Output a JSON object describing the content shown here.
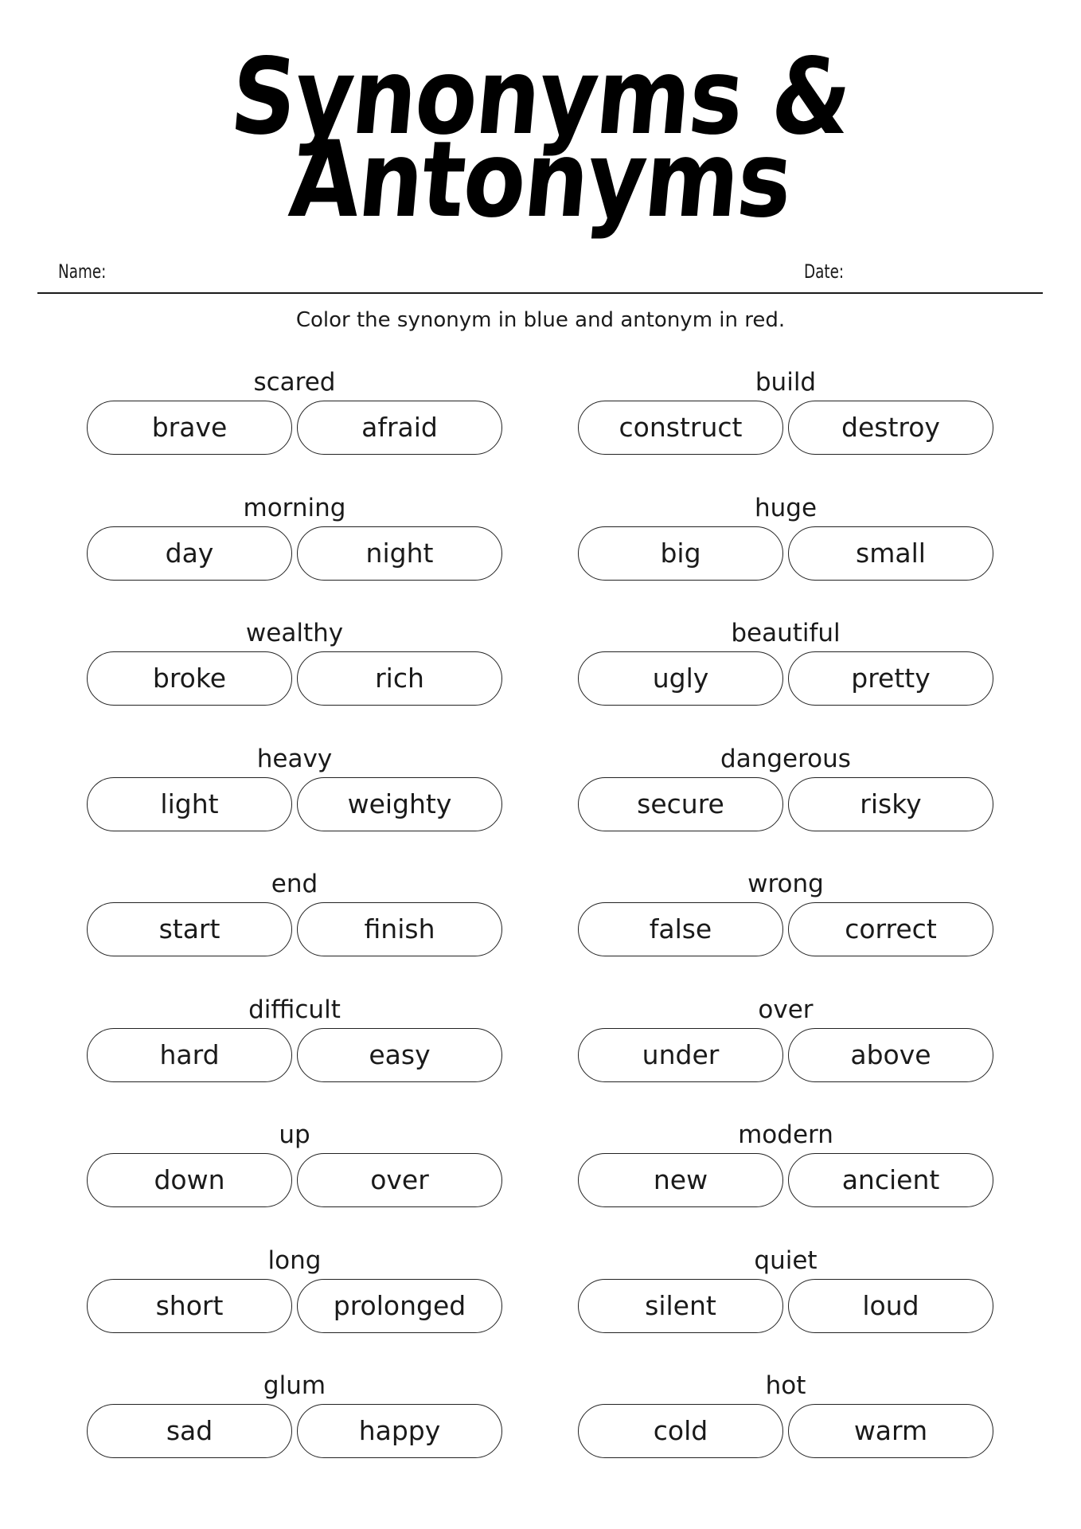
{
  "worksheet": {
    "title_line1": "Synonyms &",
    "title_line2": "Antonyms",
    "name_label": "Name:",
    "date_label": "Date:",
    "instructions": "Color the synonym in blue and antonym in red."
  },
  "left_column": [
    {
      "word": "scared",
      "options": [
        "brave",
        "afraid"
      ]
    },
    {
      "word": "morning",
      "options": [
        "day",
        "night"
      ]
    },
    {
      "word": "wealthy",
      "options": [
        "broke",
        "rich"
      ]
    },
    {
      "word": "heavy",
      "options": [
        "light",
        "weighty"
      ]
    },
    {
      "word": "end",
      "options": [
        "start",
        "finish"
      ]
    },
    {
      "word": "difficult",
      "options": [
        "hard",
        "easy"
      ]
    },
    {
      "word": "up",
      "options": [
        "down",
        "over"
      ]
    },
    {
      "word": "long",
      "options": [
        "short",
        "prolonged"
      ]
    },
    {
      "word": "glum",
      "options": [
        "sad",
        "happy"
      ]
    }
  ],
  "right_column": [
    {
      "word": "build",
      "options": [
        "construct",
        "destroy"
      ]
    },
    {
      "word": "huge",
      "options": [
        "big",
        "small"
      ]
    },
    {
      "word": "beautiful",
      "options": [
        "ugly",
        "pretty"
      ]
    },
    {
      "word": "dangerous",
      "options": [
        "secure",
        "risky"
      ]
    },
    {
      "word": "wrong",
      "options": [
        "false",
        "correct"
      ]
    },
    {
      "word": "over",
      "options": [
        "under",
        "above"
      ]
    },
    {
      "word": "modern",
      "options": [
        "new",
        "ancient"
      ]
    },
    {
      "word": "quiet",
      "options": [
        "silent",
        "loud"
      ]
    },
    {
      "word": "hot",
      "options": [
        "cold",
        "warm"
      ]
    }
  ]
}
